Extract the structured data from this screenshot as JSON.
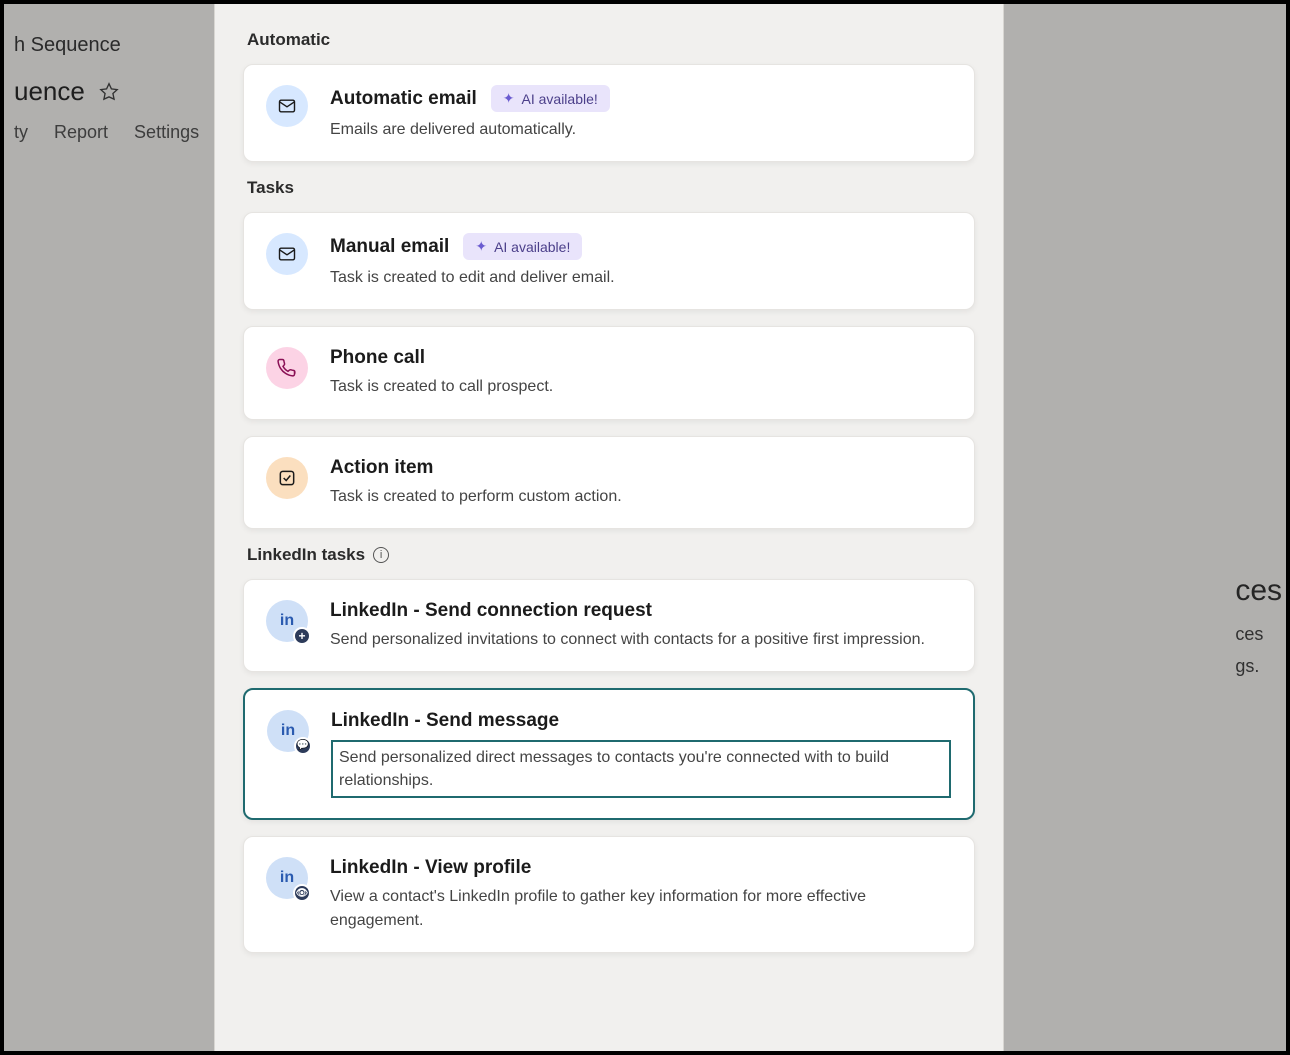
{
  "background": {
    "breadcrumb": "h Sequence",
    "title": "uence",
    "tabs": [
      "ty",
      "Report",
      "Settings"
    ],
    "right": {
      "line1": "ces",
      "line2": "ces",
      "line3": "gs."
    }
  },
  "sections": {
    "automatic": {
      "label": "Automatic"
    },
    "tasks": {
      "label": "Tasks"
    },
    "linkedin": {
      "label": "LinkedIn tasks"
    }
  },
  "ai_badge": "AI available!",
  "cards": {
    "auto_email": {
      "title": "Automatic email",
      "desc": "Emails are delivered automatically."
    },
    "manual_email": {
      "title": "Manual email",
      "desc": "Task is created to edit and deliver email."
    },
    "phone_call": {
      "title": "Phone call",
      "desc": "Task is created to call prospect."
    },
    "action_item": {
      "title": "Action item",
      "desc": "Task is created to perform custom action."
    },
    "li_connect": {
      "title": "LinkedIn - Send connection request",
      "desc": "Send personalized invitations to connect with contacts for a positive first impression."
    },
    "li_message": {
      "title": "LinkedIn - Send message",
      "desc": "Send personalized direct messages to contacts you're connected with to build relationships."
    },
    "li_view": {
      "title": "LinkedIn - View profile",
      "desc": "View a contact's LinkedIn profile to gather key information for more effective engagement."
    }
  },
  "linkedin_icon_text": "in"
}
